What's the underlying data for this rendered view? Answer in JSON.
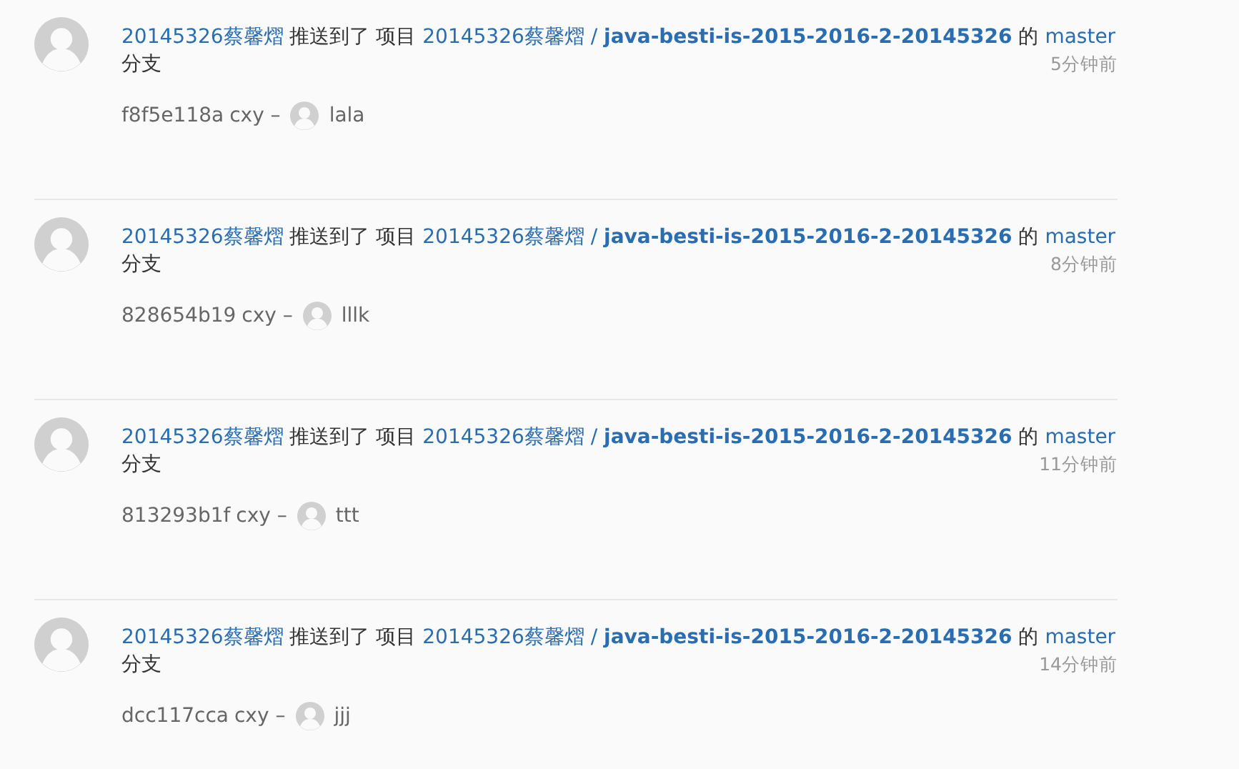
{
  "events": [
    {
      "user": "20145326蔡馨熠",
      "verb": "推送到了 项目",
      "owner": "20145326蔡馨熠",
      "sep": "/",
      "repo": "java-besti-is-2015-2016-2-20145326",
      "of": "的",
      "branch": "master",
      "suffix": "分支",
      "time": "5分钟前",
      "commit": {
        "hash": "f8f5e118a",
        "author": "cxy –",
        "message": "lala"
      }
    },
    {
      "user": "20145326蔡馨熠",
      "verb": "推送到了 项目",
      "owner": "20145326蔡馨熠",
      "sep": "/",
      "repo": "java-besti-is-2015-2016-2-20145326",
      "of": "的",
      "branch": "master",
      "suffix": "分支",
      "time": "8分钟前",
      "commit": {
        "hash": "828654b19",
        "author": "cxy –",
        "message": "lllk"
      }
    },
    {
      "user": "20145326蔡馨熠",
      "verb": "推送到了 项目",
      "owner": "20145326蔡馨熠",
      "sep": "/",
      "repo": "java-besti-is-2015-2016-2-20145326",
      "of": "的",
      "branch": "master",
      "suffix": "分支",
      "time": "11分钟前",
      "commit": {
        "hash": "813293b1f",
        "author": "cxy –",
        "message": "ttt"
      }
    },
    {
      "user": "20145326蔡馨熠",
      "verb": "推送到了 项目",
      "owner": "20145326蔡馨熠",
      "sep": "/",
      "repo": "java-besti-is-2015-2016-2-20145326",
      "of": "的",
      "branch": "master",
      "suffix": "分支",
      "time": "14分钟前",
      "commit": {
        "hash": "dcc117cca",
        "author": "cxy –",
        "message": "jjj"
      }
    }
  ]
}
